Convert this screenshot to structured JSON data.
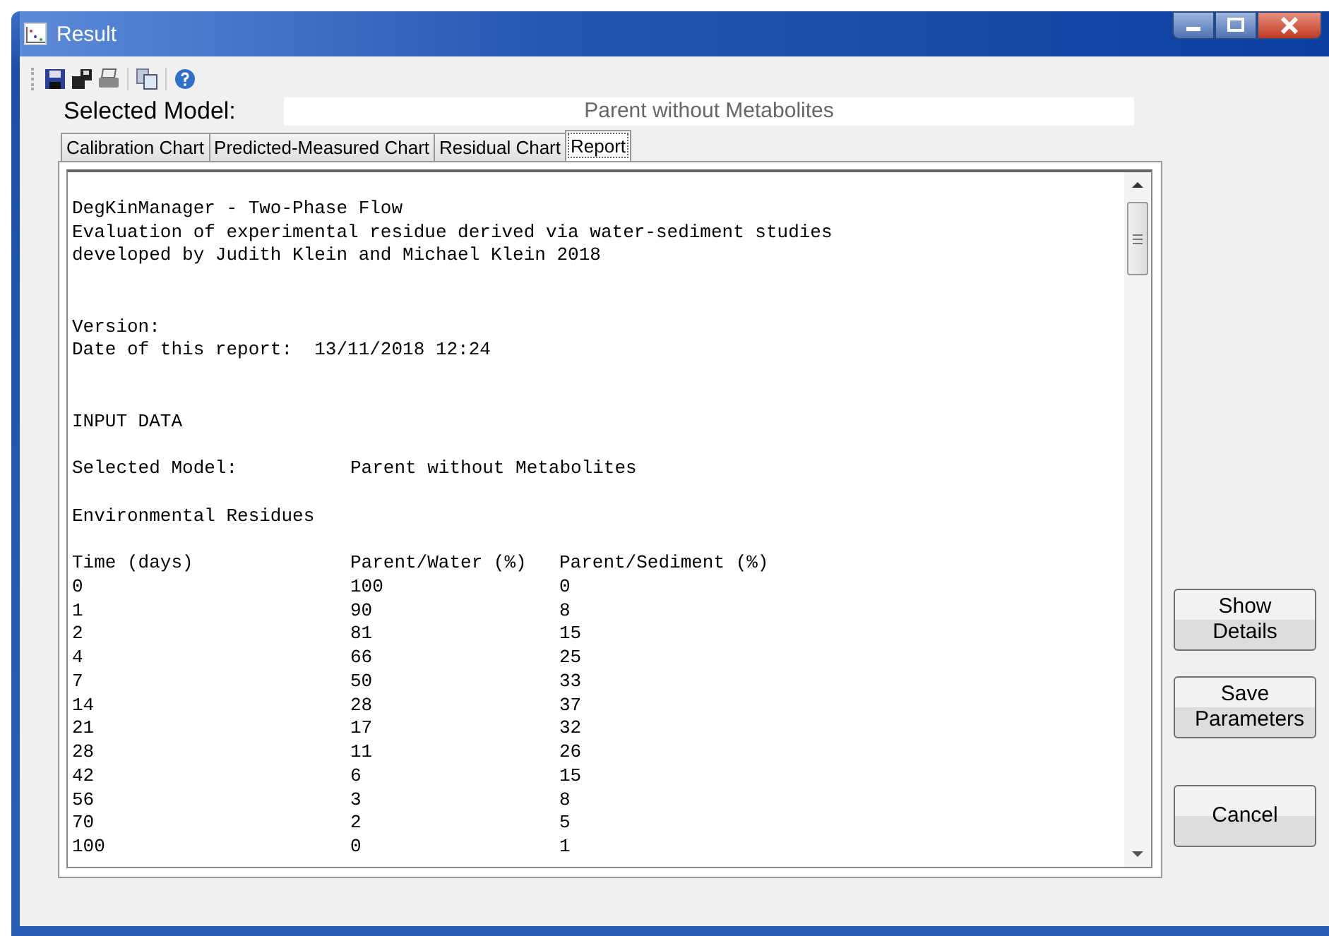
{
  "window": {
    "title": "Result"
  },
  "toolbar": [
    {
      "kind": "save"
    },
    {
      "kind": "save-all"
    },
    {
      "kind": "print"
    },
    {
      "kind": "copy"
    },
    {
      "kind": "help"
    }
  ],
  "selected_model": {
    "label": "Selected Model:",
    "value": "Parent without Metabolites"
  },
  "tabs": [
    {
      "label": "Calibration Chart",
      "selected": false
    },
    {
      "label": "Predicted-Measured Chart",
      "selected": false
    },
    {
      "label": "Residual Chart",
      "selected": false
    },
    {
      "label": "Report",
      "selected": true
    }
  ],
  "report": {
    "lines": [
      {
        "kind": "blank"
      },
      {
        "kind": "text",
        "text": "DegKinManager - Two-Phase Flow"
      },
      {
        "kind": "text",
        "text": "Evaluation of experimental residue derived via water-sediment studies"
      },
      {
        "kind": "text",
        "text": "developed by Judith Klein and Michael Klein 2018"
      },
      {
        "kind": "blank"
      },
      {
        "kind": "blank"
      },
      {
        "kind": "text",
        "text": "Version:"
      },
      {
        "kind": "text",
        "text": "Date of this report:  13/11/2018 12:24"
      },
      {
        "kind": "blank"
      },
      {
        "kind": "blank"
      },
      {
        "kind": "text",
        "text": "INPUT DATA"
      },
      {
        "kind": "blank"
      },
      {
        "kind": "row",
        "cells": [
          "Selected Model:",
          "Parent without Metabolites"
        ]
      },
      {
        "kind": "blank"
      },
      {
        "kind": "text",
        "text": "Environmental Residues"
      },
      {
        "kind": "blank"
      },
      {
        "kind": "row",
        "cells": [
          "Time (days)",
          "Parent/Water (%)",
          "Parent/Sediment (%)"
        ]
      },
      {
        "kind": "row",
        "cells": [
          "0",
          "100",
          "0"
        ]
      },
      {
        "kind": "row",
        "cells": [
          "1",
          "90",
          "8"
        ]
      },
      {
        "kind": "row",
        "cells": [
          "2",
          "81",
          "15"
        ]
      },
      {
        "kind": "row",
        "cells": [
          "4",
          "66",
          "25"
        ]
      },
      {
        "kind": "row",
        "cells": [
          "7",
          "50",
          "33"
        ]
      },
      {
        "kind": "row",
        "cells": [
          "14",
          "28",
          "37"
        ]
      },
      {
        "kind": "row",
        "cells": [
          "21",
          "17",
          "32"
        ]
      },
      {
        "kind": "row",
        "cells": [
          "28",
          "11",
          "26"
        ]
      },
      {
        "kind": "row",
        "cells": [
          "42",
          "6",
          "15"
        ]
      },
      {
        "kind": "row",
        "cells": [
          "56",
          "3",
          "8"
        ]
      },
      {
        "kind": "row",
        "cells": [
          "70",
          "2",
          "5"
        ]
      },
      {
        "kind": "row",
        "cells": [
          "100",
          "0",
          "1"
        ]
      }
    ]
  },
  "buttons": [
    {
      "label": "Show Details"
    },
    {
      "label": "Save Parameters"
    },
    {
      "label": "Cancel"
    }
  ]
}
